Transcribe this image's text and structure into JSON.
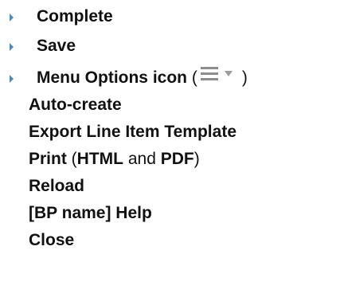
{
  "items": [
    {
      "label": "Complete"
    },
    {
      "label": "Save"
    },
    {
      "label": "Menu Options icon",
      "suffix_open": " (",
      "suffix_close": ")"
    }
  ],
  "menu_options": [
    {
      "label": "Auto-create"
    },
    {
      "label": "Export Line Item Template"
    },
    {
      "label_print": "Print",
      "paren_open": " (",
      "html": "HTML",
      "and": " and ",
      "pdf": "PDF",
      "paren_close": ")"
    },
    {
      "label": "Reload"
    },
    {
      "label": "[BP name] Help"
    },
    {
      "label": "Close"
    }
  ],
  "icons": {
    "bullet": "triangle-right",
    "menu": "hamburger-with-dropdown-caret",
    "bullet_color": "#4a8ac4",
    "icon_color": "#8c8c8c"
  }
}
